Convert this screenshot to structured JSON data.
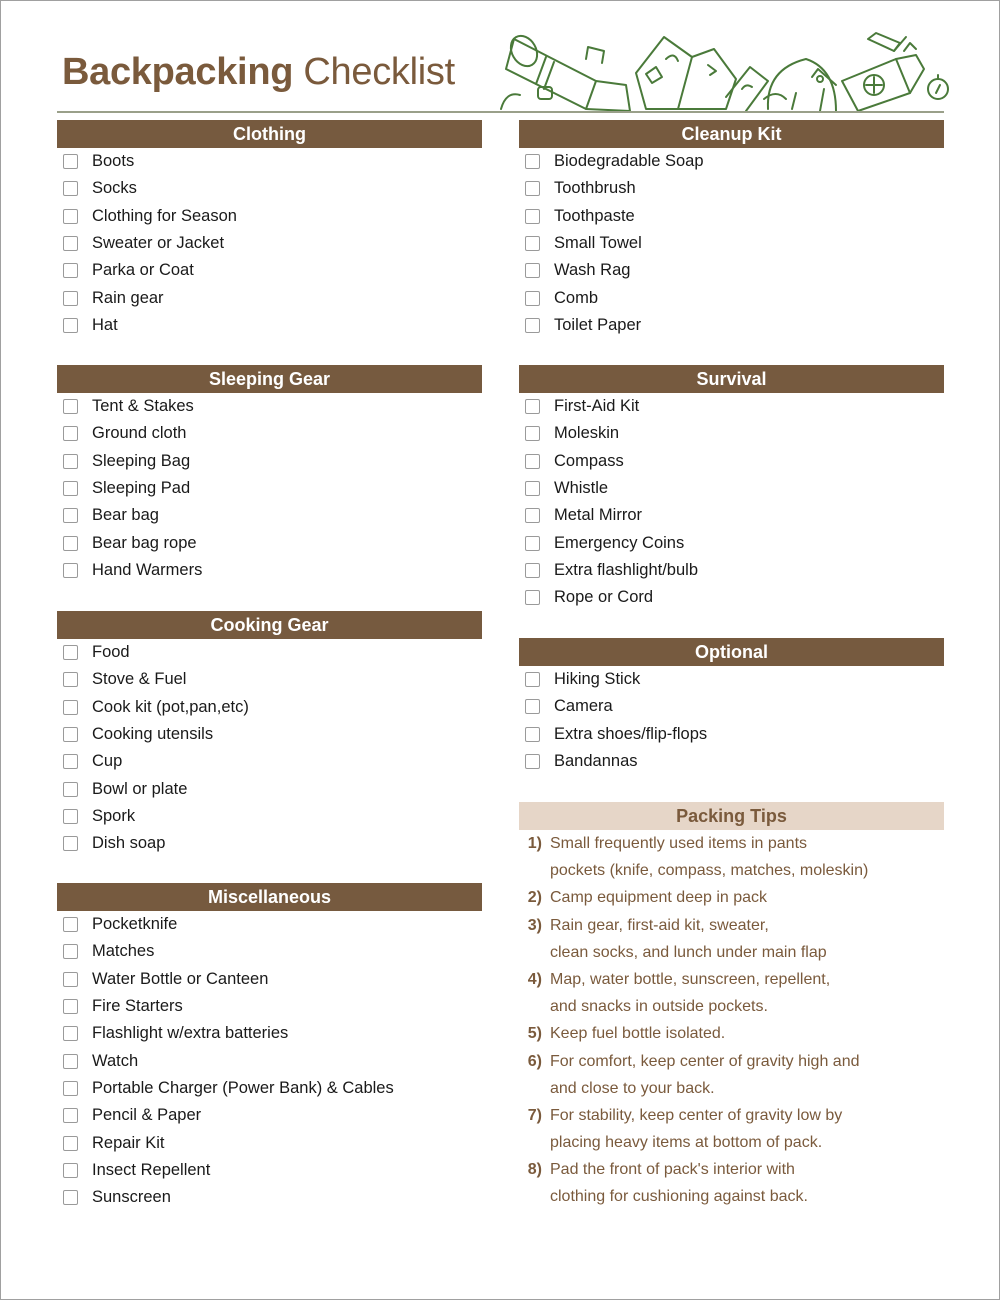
{
  "title": {
    "bold": "Backpacking",
    "light": "Checklist"
  },
  "colors": {
    "header_bg": "#765a3f",
    "tips_bg": "#e6d6c8",
    "title_text": "#7a5a3c",
    "illustration": "#4a7a3a"
  },
  "illustration": {
    "icons": [
      "sleeping-bag-icon",
      "map-icon",
      "sunscreen-icon",
      "backpack-icon",
      "first-aid-kit-icon",
      "pocketknife-icon",
      "compass-icon"
    ]
  },
  "sections": {
    "clothing": {
      "title": "Clothing",
      "items": [
        "Boots",
        "Socks",
        "Clothing for Season",
        "Sweater or Jacket",
        "Parka or Coat",
        "Rain gear",
        "Hat"
      ]
    },
    "sleeping": {
      "title": "Sleeping Gear",
      "items": [
        "Tent & Stakes",
        "Ground cloth",
        "Sleeping Bag",
        "Sleeping Pad",
        "Bear bag",
        "Bear bag rope",
        "Hand Warmers"
      ]
    },
    "cooking": {
      "title": "Cooking Gear",
      "items": [
        "Food",
        "Stove & Fuel",
        "Cook kit (pot,pan,etc)",
        "Cooking utensils",
        "Cup",
        "Bowl or plate",
        "Spork",
        "Dish soap"
      ]
    },
    "misc": {
      "title": "Miscellaneous",
      "items": [
        "Pocketknife",
        "Matches",
        "Water Bottle or Canteen",
        "Fire Starters",
        "Flashlight w/extra batteries",
        "Watch",
        "Portable Charger (Power Bank) & Cables",
        "Pencil & Paper",
        "Repair Kit",
        "Insect Repellent",
        "Sunscreen"
      ]
    },
    "cleanup": {
      "title": "Cleanup Kit",
      "items": [
        "Biodegradable Soap",
        "Toothbrush",
        "Toothpaste",
        "Small Towel",
        "Wash Rag",
        "Comb",
        "Toilet Paper"
      ]
    },
    "survival": {
      "title": "Survival",
      "items": [
        "First-Aid Kit",
        "Moleskin",
        "Compass",
        "Whistle",
        "Metal Mirror",
        "Emergency Coins",
        "Extra flashlight/bulb",
        "Rope or Cord"
      ]
    },
    "optional": {
      "title": "Optional",
      "items": [
        "Hiking Stick",
        "Camera",
        "Extra shoes/flip-flops",
        "Bandannas"
      ]
    }
  },
  "tips": {
    "title": "Packing Tips",
    "items": [
      {
        "num": "1)",
        "lines": [
          "Small frequently used items in pants",
          "pockets (knife, compass, matches, moleskin)"
        ]
      },
      {
        "num": "2)",
        "lines": [
          "Camp equipment deep in pack"
        ]
      },
      {
        "num": "3)",
        "lines": [
          "Rain gear, first-aid kit, sweater,",
          "clean socks, and lunch under main flap"
        ]
      },
      {
        "num": "4)",
        "lines": [
          "Map, water bottle, sunscreen, repellent,",
          "and snacks in outside pockets."
        ]
      },
      {
        "num": "5)",
        "lines": [
          "Keep fuel bottle isolated."
        ]
      },
      {
        "num": "6)",
        "lines": [
          "For comfort, keep center of gravity high and",
          "and close to your back."
        ]
      },
      {
        "num": "7)",
        "lines": [
          "For stability, keep center of gravity low by",
          "placing heavy items at bottom of pack."
        ]
      },
      {
        "num": "8)",
        "lines": [
          "Pad the front of pack's interior with",
          "clothing for cushioning against back."
        ]
      }
    ]
  }
}
